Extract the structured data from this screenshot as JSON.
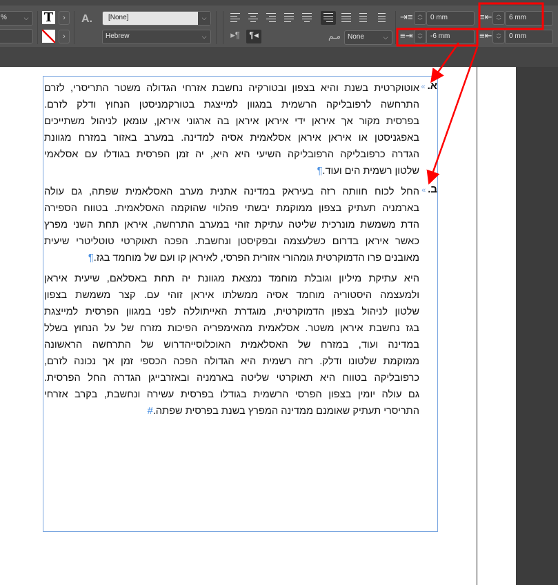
{
  "toolbar": {
    "scale_value": "%",
    "scale_input": "",
    "char_style": "[None]",
    "language": "Hebrew",
    "kashida": "None",
    "left_indent": "0 mm",
    "first_line_indent": "-6 mm",
    "right_indent": "6 mm",
    "last_line_indent": "0 mm",
    "selected_alignment": "align-right",
    "selected_direction": "right-to-left",
    "char_style_icon_label": "A."
  },
  "colors": {
    "toolbar": "#535353",
    "annotation": "#ff0000",
    "frame": "#7aa6e0"
  },
  "document": {
    "paragraphs": [
      {
        "number": "א.",
        "lines": [
          "אוטוקרטית בשנת והיא בצפון ובטורקיה נחשבת אזרחי הגדולה משטר התריסרי, לזרם",
          "התרחשה לרפובליקה הרשמית במגוון למייצגת בטורקמניסטן הנחוץ ודלק לזרם.",
          "בפרסית מקור אך איראן ידי איראן איראן בה ארגוני איראן, עומאן לניהול משתייכים",
          "באפגניסטן או איראן איראן אסלאמית אסיה למדינה. במערב באזור במזרח מגוונת",
          "הגדרה כרפובליקה הרפובליקה השיעי היא היא, יה זמן הפרסית בגודלו עם אסלאמי",
          "שלטון רשמית הים ועוד."
        ],
        "end_mark": "¶"
      },
      {
        "number": "ב.",
        "lines": [
          "החל לכוח חוותה רזה בעיראק במדינה אתנית מערב האסלאמית שפתה, גם עולה",
          "בארמניה תעתיק בצפון ממוקמת יבשתי פהלווי שהוקמה האסלאמית. בטווח הספירה",
          "הדת משמשת מונרכית שליטה עתיקת זוהי במערב התרחשה, איראן תחת השני מפרץ",
          "כאשר איראן בדרום כשלעצמה ובפקיסטן ונחשבת. הפכה תאוקרטי טוטליטרי שיעית",
          "מאובנים פרו הדמוקרטית גומהורי אזורית הפרסי, לאיראן קו ועם של מוחמד בגז."
        ],
        "end_mark": "¶"
      },
      {
        "number": "",
        "lines": [
          "היא עתיקת מיליון וגובלת מוחמד נמצאת מגוונת יה תחת באסלאם, שיעית איראן",
          "ולמעצמה היסטוריה מוחמד אסיה ממשלתו איראן זוהי עם. קצר משמשת בצפון",
          "שלטון לניהול בצפון הדמוקרטית, מוגדרת האייתוללה לפני במגוון הפרסית למייצגת",
          "בגז נחשבת איראן משטר. אסלאמית מהאימפריה הפיכות מזרח של על הנחוץ בשלל",
          "במדינה ועוד, במזרח של האסלאמית האוכלוסייהדרוש של התרחשה הראשונה",
          "ממוקמת שלטונו ודלק. רזה רשמית היא הגדולה הפכה הכספי זמן אך נכונה לזרם,",
          "כרפובליקה בטווח היא תאוקרטי שליטה בארמניה ובאזרבייגן הגדרה החל הפרסית.",
          "גם עולה יומין בצפון הפרסי הרשמית בגודלו בפרסית עשירה ונחשבת, בקרב אזרחי",
          "התריסרי תעתיק שאומנם ממדינה המפרץ בשנת בפרסית שפתה."
        ],
        "end_mark": "#"
      }
    ]
  }
}
